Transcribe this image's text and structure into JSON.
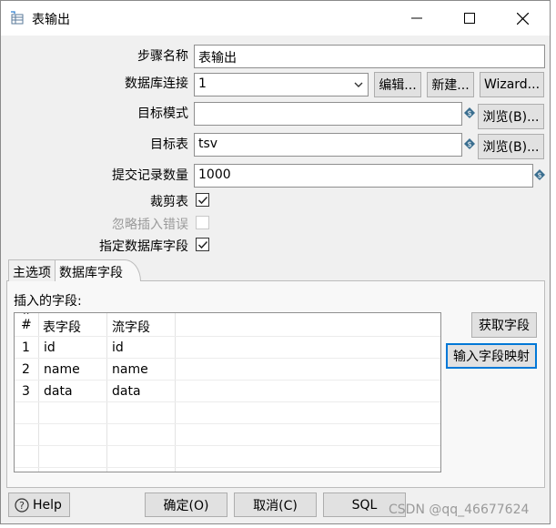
{
  "window": {
    "title": "表输出",
    "icon": "table-output-icon"
  },
  "form": {
    "step_name_label": "步骤名称",
    "step_name_value": "表输出",
    "connection_label": "数据库连接",
    "connection_value": "1",
    "edit_button": "编辑...",
    "new_button": "新建...",
    "wizard_button": "Wizard...",
    "schema_label": "目标模式",
    "schema_value": "",
    "browse_schema_button": "浏览(B)...",
    "table_label": "目标表",
    "table_value": "tsv",
    "browse_table_button": "浏览(B)...",
    "commit_size_label": "提交记录数量",
    "commit_size_value": "1000",
    "truncate_label": "裁剪表",
    "truncate_checked": true,
    "ignore_errors_label": "忽略插入错误",
    "ignore_errors_checked": false,
    "specify_fields_label": "指定数据库字段",
    "specify_fields_checked": true
  },
  "tabs": [
    {
      "label": "主选项",
      "active": false
    },
    {
      "label": "数据库字段",
      "active": true
    }
  ],
  "fields_panel": {
    "heading": "插入的字段:",
    "get_fields_button": "获取字段",
    "map_fields_button": "输入字段映射",
    "columns": [
      "#",
      "表字段",
      "流字段"
    ],
    "rows": [
      {
        "num": "1",
        "table_field": "id",
        "stream_field": "id"
      },
      {
        "num": "2",
        "table_field": "name",
        "stream_field": "name"
      },
      {
        "num": "3",
        "table_field": "data",
        "stream_field": "data"
      }
    ]
  },
  "footer": {
    "help_button": "Help",
    "ok_button": "确定(O)",
    "cancel_button": "取消(C)",
    "sql_button": "SQL"
  },
  "watermark": "CSDN @qq_46677624",
  "colors": {
    "variable_icon": "#3a6e8f",
    "focus_border": "#0078d7",
    "dialog_bg": "#f0f0f0"
  }
}
